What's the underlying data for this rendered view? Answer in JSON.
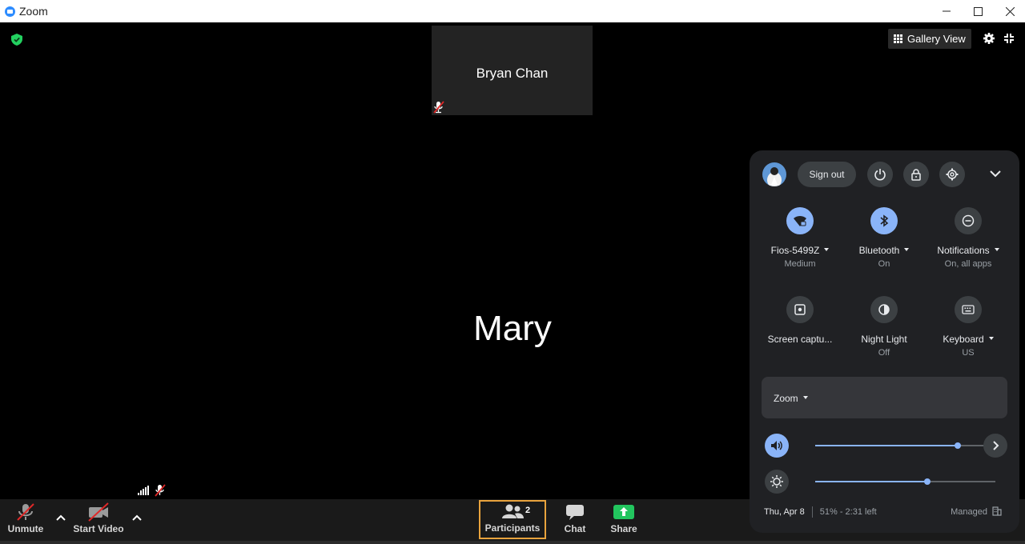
{
  "window": {
    "title": "Zoom",
    "controls": [
      "–",
      "□",
      "✕"
    ]
  },
  "meeting": {
    "thumbnail_name": "Bryan Chan",
    "active_speaker": "Mary",
    "gallery_view_label": "Gallery View"
  },
  "toolbar": {
    "unmute_label": "Unmute",
    "start_video_label": "Start Video",
    "participants_label": "Participants",
    "participants_count": "2",
    "chat_label": "Chat",
    "share_label": "Share"
  },
  "quick_settings": {
    "sign_out_label": "Sign out",
    "tiles": [
      {
        "label": "Fios-5499Z",
        "sub": "Medium",
        "icon": "wifi-icon",
        "on": true,
        "dropdown": true
      },
      {
        "label": "Bluetooth",
        "sub": "On",
        "icon": "bluetooth-icon",
        "on": true,
        "dropdown": true
      },
      {
        "label": "Notifications",
        "sub": "On, all apps",
        "icon": "do-not-disturb-icon",
        "on": false,
        "dropdown": true
      },
      {
        "label": "Screen captu...",
        "sub": "",
        "icon": "screen-capture-icon",
        "on": false,
        "dropdown": false
      },
      {
        "label": "Night Light",
        "sub": "Off",
        "icon": "night-light-icon",
        "on": false,
        "dropdown": false
      },
      {
        "label": "Keyboard",
        "sub": "US",
        "icon": "keyboard-icon",
        "on": false,
        "dropdown": true
      }
    ],
    "media_label": "Zoom",
    "volume_level": 0.79,
    "brightness_level": 0.62,
    "date": "Thu, Apr 8",
    "battery": "51% - 2:31 left",
    "managed_label": "Managed"
  },
  "colors": {
    "accent": "#8ab4f8",
    "participants_border": "#e8a33d",
    "share_green": "#22c55e",
    "shield_green": "#23d160"
  }
}
